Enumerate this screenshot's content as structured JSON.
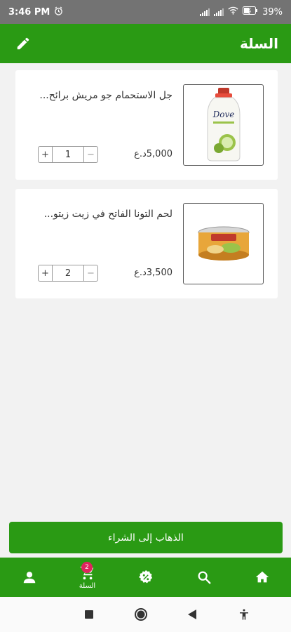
{
  "status_bar": {
    "time": "3:46 PM",
    "battery": "39%"
  },
  "header": {
    "title": "السلة",
    "edit_icon": "pencil-icon"
  },
  "cart": {
    "items": [
      {
        "name": "جل الاستحمام جو مريش برائح...",
        "price": "5,000د.ع",
        "quantity": "1",
        "image": "dove-bottle"
      },
      {
        "name": "لحم التونا الفاتح في زيت زيتو...",
        "price": "3,500د.ع",
        "quantity": "2",
        "image": "tuna-can"
      }
    ]
  },
  "checkout": {
    "label": "الذهاب إلى الشراء"
  },
  "bottom_nav": {
    "items": [
      {
        "icon": "person-icon",
        "label": ""
      },
      {
        "icon": "cart-icon",
        "label": "السلة",
        "badge": "2"
      },
      {
        "icon": "offers-icon",
        "label": ""
      },
      {
        "icon": "search-icon",
        "label": ""
      },
      {
        "icon": "home-icon",
        "label": ""
      }
    ]
  },
  "colors": {
    "primary": "#2a9a14",
    "badge": "#e0245e",
    "background": "#f2f2f2"
  }
}
